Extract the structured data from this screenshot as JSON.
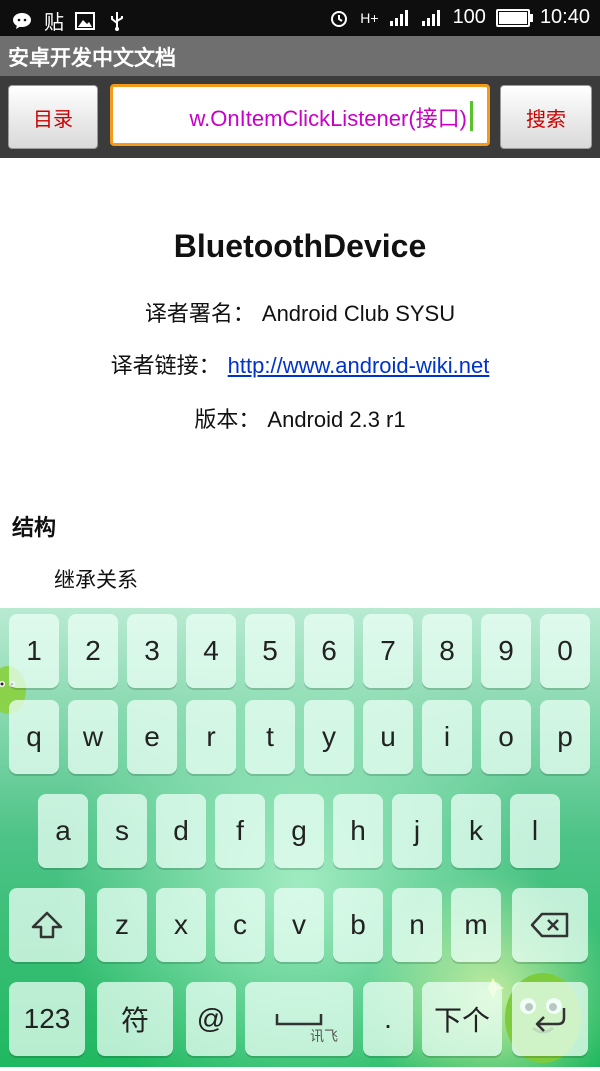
{
  "statusbar": {
    "left_icons": [
      "chat-icon",
      "sticker-label",
      "image-icon",
      "usb-icon"
    ],
    "sticker_label": "贴",
    "signal": "H+",
    "battery": "100",
    "time": "10:40"
  },
  "app": {
    "title": "安卓开发中文文档"
  },
  "toolbar": {
    "dir_label": "目录",
    "search_value": "w.OnItemClickListener(接口)",
    "search_label": "搜索"
  },
  "doc": {
    "title": "BluetoothDevice",
    "translator_label": "译者署名：",
    "translator_value": "Android Club SYSU",
    "link_label": "译者链接：",
    "link_value": "http://www.android-wiki.net",
    "version_label": "版本：",
    "version_value": "Android 2.3 r1",
    "section": "结构",
    "section_item": "继承关系"
  },
  "keyboard": {
    "row1": [
      "1",
      "2",
      "3",
      "4",
      "5",
      "6",
      "7",
      "8",
      "9",
      "0"
    ],
    "row2": [
      "q",
      "w",
      "e",
      "r",
      "t",
      "y",
      "u",
      "i",
      "o",
      "p"
    ],
    "row3": [
      "a",
      "s",
      "d",
      "f",
      "g",
      "h",
      "j",
      "k",
      "l"
    ],
    "row4": [
      "z",
      "x",
      "c",
      "v",
      "b",
      "n",
      "m"
    ],
    "num_label": "123",
    "symbol_label": "符",
    "at_label": "@",
    "period_label": ".",
    "next_label": "下个",
    "brand": "讯飞",
    "icons": [
      "shift-icon",
      "backspace-icon",
      "space-icon",
      "enter-icon"
    ]
  }
}
